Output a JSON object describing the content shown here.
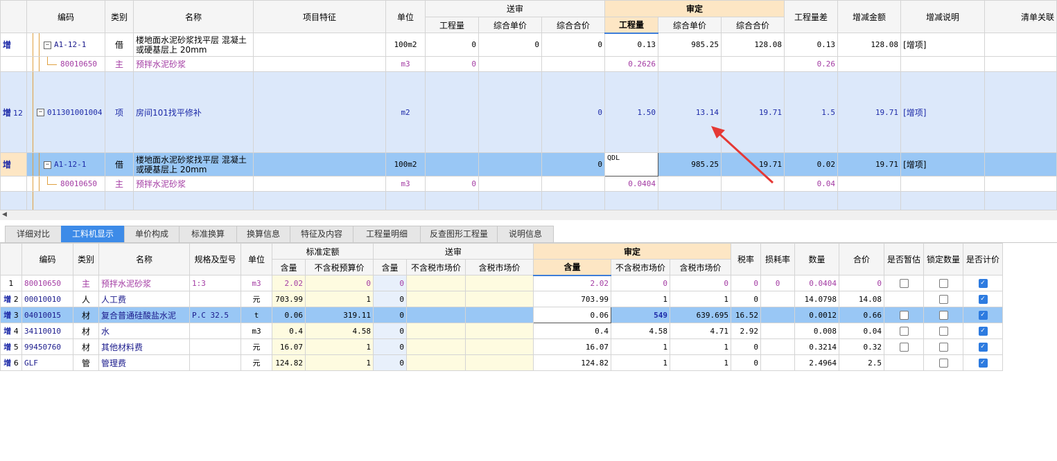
{
  "top_headers": {
    "code": "编码",
    "category": "类别",
    "name": "名称",
    "feature": "项目特征",
    "unit": "单位",
    "send": "送审",
    "send_qty": "工程量",
    "send_price": "综合单价",
    "send_total": "综合合价",
    "audit": "审定",
    "audit_qty": "工程量",
    "audit_price": "综合单价",
    "audit_total": "综合合价",
    "qty_diff": "工程量差",
    "amount_change": "增减金额",
    "change_note": "增减说明",
    "list_link": "清单关联"
  },
  "top_rows": [
    {
      "mark": "增",
      "no": "",
      "code": "A1-12-1",
      "cat": "借",
      "name": "楼地面水泥砂浆找平层 混凝土或硬基层上 20mm",
      "unit": "100m2",
      "s_qty": "0",
      "s_price": "0",
      "s_total": "0",
      "a_qty": "0.13",
      "a_price": "985.25",
      "a_total": "128.08",
      "diff": "0.13",
      "amt": "128.08",
      "note": "[增项]"
    },
    {
      "mark": "",
      "no": "",
      "code": "80010650",
      "cat": "主",
      "name": "预拌水泥砂浆",
      "unit": "m3",
      "s_qty": "0",
      "s_price": "",
      "s_total": "",
      "a_qty": "0.2626",
      "a_price": "",
      "a_total": "",
      "diff": "0.26",
      "amt": "",
      "note": ""
    },
    {
      "mark": "增",
      "no": "12",
      "code": "011301001004",
      "cat": "项",
      "name": "房间101找平修补",
      "unit": "m2",
      "s_qty": "",
      "s_price": "",
      "s_total": "0",
      "a_qty": "1.50",
      "a_price": "13.14",
      "a_total": "19.71",
      "diff": "1.5",
      "amt": "19.71",
      "note": "[增项]"
    },
    {
      "mark": "增",
      "no": "",
      "code": "A1-12-1",
      "cat": "借",
      "name": "楼地面水泥砂浆找平层 混凝土或硬基层上 20mm",
      "unit": "100m2",
      "s_qty": "",
      "s_price": "",
      "s_total": "0",
      "a_qty": "QDL",
      "a_price": "985.25",
      "a_total": "19.71",
      "diff": "0.02",
      "amt": "19.71",
      "note": "[增项]"
    },
    {
      "mark": "",
      "no": "",
      "code": "80010650",
      "cat": "主",
      "name": "预拌水泥砂浆",
      "unit": "m3",
      "s_qty": "0",
      "s_price": "",
      "s_total": "",
      "a_qty": "0.0404",
      "a_price": "",
      "a_total": "",
      "diff": "0.04",
      "amt": "",
      "note": ""
    }
  ],
  "tabs": [
    "详细对比",
    "工料机显示",
    "单价构成",
    "标准换算",
    "换算信息",
    "特征及内容",
    "工程量明细",
    "反查图形工程量",
    "说明信息"
  ],
  "active_tab": 1,
  "bot_headers": {
    "code": "编码",
    "cat": "类别",
    "name": "名称",
    "spec": "规格及型号",
    "unit": "单位",
    "std": "标准定额",
    "std_qty": "含量",
    "std_price": "不含税预算价",
    "send": "送审",
    "send_qty": "含量",
    "send_mkt": "不含税市场价",
    "send_mkt_tax": "含税市场价",
    "audit": "审定",
    "audit_qty": "含量",
    "audit_mkt": "不含税市场价",
    "audit_mkt_tax": "含税市场价",
    "tax": "税率",
    "loss": "损耗率",
    "count": "数量",
    "total": "合价",
    "temp": "是否暂估",
    "lock": "锁定数量",
    "price": "是否计价"
  },
  "bot_rows": [
    {
      "mark": "",
      "no": "1",
      "code": "80010650",
      "cat": "主",
      "name": "预拌水泥砂浆",
      "spec": "1:3",
      "unit": "m3",
      "std_qty": "2.02",
      "std_price": "0",
      "send_qty": "0",
      "a_qty": "2.02",
      "a_mkt": "0",
      "a_mkt_tax": "0",
      "tax": "0",
      "loss": "0",
      "count": "0.0404",
      "total": "0",
      "temp": false,
      "lock": false,
      "price": true,
      "purple": true
    },
    {
      "mark": "增",
      "no": "2",
      "code": "00010010",
      "cat": "人",
      "name": "人工费",
      "spec": "",
      "unit": "元",
      "std_qty": "703.99",
      "std_price": "1",
      "send_qty": "0",
      "a_qty": "703.99",
      "a_mkt": "1",
      "a_mkt_tax": "1",
      "tax": "0",
      "loss": "",
      "count": "14.0798",
      "total": "14.08",
      "temp": null,
      "lock": false,
      "price": true,
      "purple": false
    },
    {
      "mark": "增",
      "no": "3",
      "code": "04010015",
      "cat": "材",
      "name": "复合普通硅酸盐水泥",
      "spec": "P.C 32.5",
      "unit": "t",
      "std_qty": "0.06",
      "std_price": "319.11",
      "send_qty": "0",
      "a_qty": "0.06",
      "a_mkt": "549",
      "a_mkt_tax": "639.695",
      "tax": "16.52",
      "loss": "",
      "count": "0.0012",
      "total": "0.66",
      "temp": false,
      "lock": false,
      "price": true,
      "purple": false
    },
    {
      "mark": "增",
      "no": "4",
      "code": "34110010",
      "cat": "材",
      "name": "水",
      "spec": "",
      "unit": "m3",
      "std_qty": "0.4",
      "std_price": "4.58",
      "send_qty": "0",
      "a_qty": "0.4",
      "a_mkt": "4.58",
      "a_mkt_tax": "4.71",
      "tax": "2.92",
      "loss": "",
      "count": "0.008",
      "total": "0.04",
      "temp": false,
      "lock": false,
      "price": true,
      "purple": false
    },
    {
      "mark": "增",
      "no": "5",
      "code": "99450760",
      "cat": "材",
      "name": "其他材料费",
      "spec": "",
      "unit": "元",
      "std_qty": "16.07",
      "std_price": "1",
      "send_qty": "0",
      "a_qty": "16.07",
      "a_mkt": "1",
      "a_mkt_tax": "1",
      "tax": "0",
      "loss": "",
      "count": "0.3214",
      "total": "0.32",
      "temp": false,
      "lock": false,
      "price": true,
      "purple": false
    },
    {
      "mark": "增",
      "no": "6",
      "code": "GLF",
      "cat": "管",
      "name": "管理费",
      "spec": "",
      "unit": "元",
      "std_qty": "124.82",
      "std_price": "1",
      "send_qty": "0",
      "a_qty": "124.82",
      "a_mkt": "1",
      "a_mkt_tax": "1",
      "tax": "0",
      "loss": "",
      "count": "2.4964",
      "total": "2.5",
      "temp": null,
      "lock": false,
      "price": true,
      "purple": false
    }
  ],
  "selected_bot_row": 2,
  "colors": {
    "accent": "#3d8be8",
    "selected": "#99c7f5",
    "audit_header": "#fde6c4",
    "arrow": "#e53935"
  }
}
